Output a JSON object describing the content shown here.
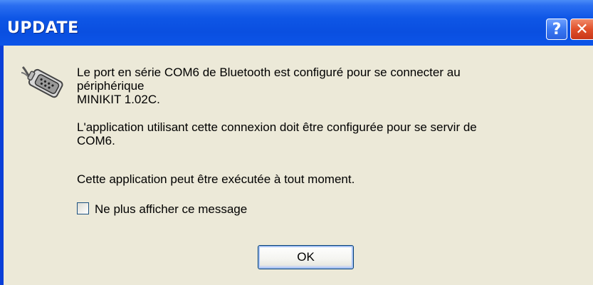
{
  "window": {
    "title": "UPDATE",
    "help_label": "?",
    "close_label": "✕"
  },
  "icon": {
    "name": "serial-port-icon"
  },
  "message": {
    "line1": "Le port en série COM6 de Bluetooth est configuré pour se connecter au",
    "line2": "périphérique",
    "line3": "MINIKIT 1.02C.",
    "line4": "L'application utilisant cette connexion doit être configurée pour se servir de",
    "line5": "COM6.",
    "line6": "Cette application peut être exécutée à tout moment."
  },
  "checkbox": {
    "label": "Ne plus afficher ce message",
    "checked": false
  },
  "buttons": {
    "ok_label": "OK"
  },
  "colors": {
    "titlebar": "#0a4fe0",
    "client": "#ece9d8",
    "close": "#e0502a"
  }
}
